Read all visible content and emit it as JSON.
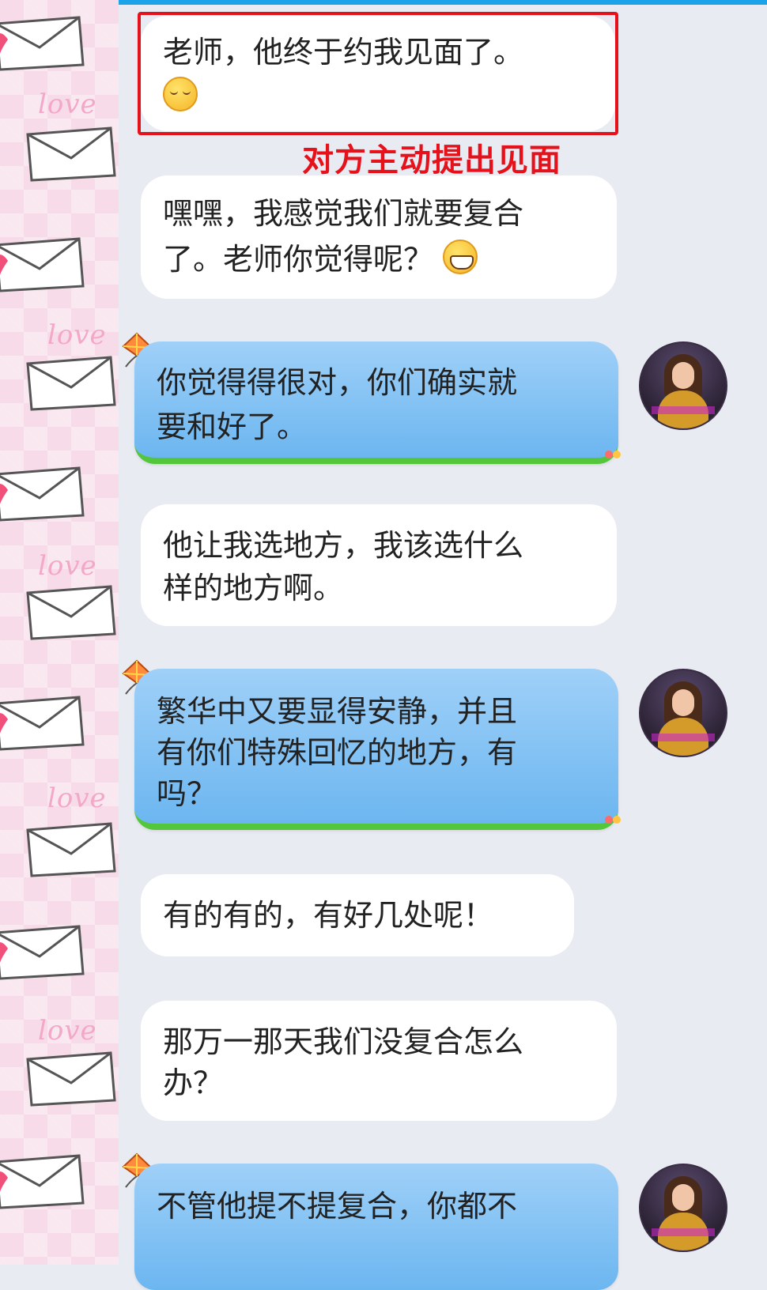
{
  "annotation": "对方主动提出见面",
  "messages": [
    {
      "side": "in",
      "line1": "老师，他终于约我见面了。",
      "emoji": "shy-emoji"
    },
    {
      "side": "in",
      "line1": "嘿嘿，我感觉我们就要复合",
      "line2": "了。老师你觉得呢？",
      "emoji": "grin-emoji"
    },
    {
      "side": "out",
      "line1": "你觉得得很对，你们确实就",
      "line2": "要和好了。"
    },
    {
      "side": "in",
      "line1": "他让我选地方，我该选什么",
      "line2": "样的地方啊。"
    },
    {
      "side": "out",
      "line1": "繁华中又要显得安静，并且",
      "line2": "有你们特殊回忆的地方，有",
      "line3": "吗？"
    },
    {
      "side": "in",
      "line1": "有的有的，有好几处呢！"
    },
    {
      "side": "in",
      "line1": "那万一那天我们没复合怎么",
      "line2": "办？"
    },
    {
      "side": "out",
      "line1": "不管他提不提复合，你都不"
    }
  ],
  "background_word": "love",
  "colors": {
    "annotation": "#e5121c",
    "incoming_bubble": "#ffffff",
    "outgoing_bubble": "#7fc2f4",
    "outgoing_border": "#54c63b",
    "topbar": "#1aa3e8"
  }
}
